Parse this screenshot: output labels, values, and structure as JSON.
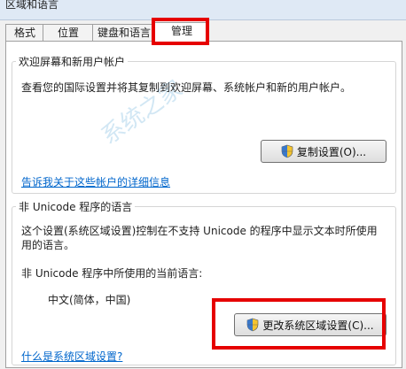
{
  "window": {
    "title": "区域和语言"
  },
  "tabs": [
    {
      "label": "格式"
    },
    {
      "label": "位置"
    },
    {
      "label": "键盘和语言"
    },
    {
      "label": "管理"
    }
  ],
  "welcome_group": {
    "title": "欢迎屏幕和新用户帐户",
    "description": "查看您的国际设置并将其复制到欢迎屏幕、系统帐户和新的用户帐户。",
    "copy_button": "复制设置(O)...",
    "link": "告诉我关于这些帐户的详细信息"
  },
  "unicode_group": {
    "title": "非 Unicode 程序的语言",
    "description_line1": "这个设置(系统区域设置)控制在不支持 Unicode 的程序中显示文本时所使用",
    "description_line2": "用的语言。",
    "current_label": "非 Unicode 程序中所使用的当前语言:",
    "current_value": "中文(简体，中国)",
    "change_button": "更改系统区域设置(C)...",
    "link": "什么是系统区域设置?"
  },
  "watermark": {
    "text": "系统之家"
  },
  "colors": {
    "highlight": "#e60000",
    "link": "#0066cc"
  }
}
